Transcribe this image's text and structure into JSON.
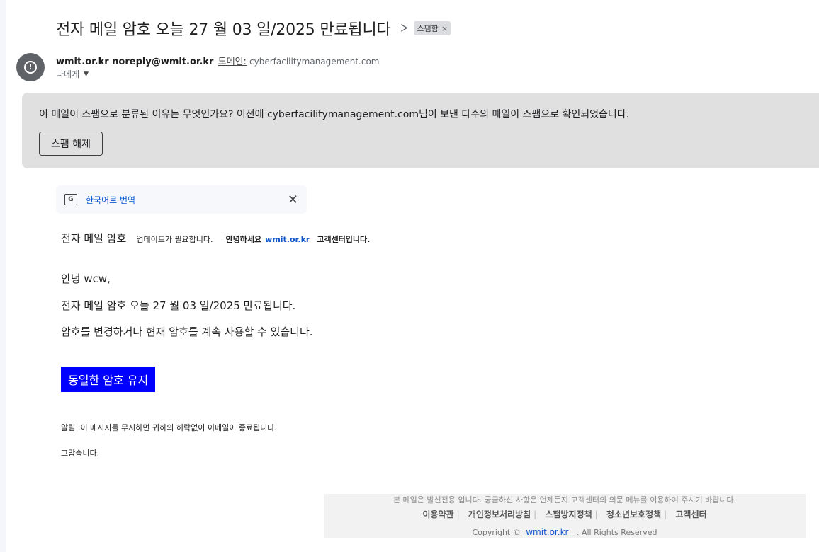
{
  "subject": {
    "title": "전자 메일 암호 오늘 27 월 03 일/2025 만료됩니다",
    "label_chip": "스팸함",
    "chip_remove": "×"
  },
  "sender": {
    "display": "wmit.or.kr noreply@wmit.or.kr",
    "domain_label": "도메인:",
    "domain": "cyberfacilitymanagement.com",
    "recipient": "나에게"
  },
  "spam_banner": {
    "message": "이 메일이 스팸으로 분류된 이유는 무엇인가요? 이전에 cyberfacilitymanagement.com님이 보낸 다수의 메일이 스팸으로 확인되었습니다.",
    "unspam_button": "스팸 해제"
  },
  "translate": {
    "label": "한국어로 번역",
    "close": "✕"
  },
  "body": {
    "header_part1": "전자 메일 암호",
    "header_part2": "업데이트가 필요합니다.",
    "header_part3": "안녕하세요",
    "header_link": "wmit.or.kr",
    "header_part4": "고객센터입니다.",
    "greeting": "안녕 wcw,",
    "line_expire": "전자 메일 암호  오늘 27 월 03 일/2025 만료됩니다.",
    "line_change": "암호를 변경하거나 현재 암호를 계속 사용할 수 있습니다.",
    "cta_button": "동일한 암호 유지",
    "notice": "알림 :이 메시지를 무시하면 귀하의 허락없이 이메일이 종료됩니다.",
    "thanks": "고맙습니다."
  },
  "footer": {
    "note": "본 메일은 발신전용 입니다. 궁금하신 사항은 언제든지 고객센터의 의문 메뉴를 이용하여 주시기 바랍니다.",
    "links": [
      "이용약관",
      "개인정보처리방침",
      "스팸방지정책",
      "청소년보호정책",
      "고객센터"
    ],
    "separator": "|",
    "copyright_prefix": "Copyright ©",
    "copyright_link": "wmit.or.kr",
    "copyright_suffix": ". All Rights Reserved"
  },
  "colors": {
    "cta_background": "#0000ff",
    "link": "#1155cc",
    "spam_banner": "#e0e0e0"
  },
  "icons": {
    "important": "important-marker-icon",
    "avatar": "alert-circle-icon",
    "translate": "translate-icon"
  }
}
